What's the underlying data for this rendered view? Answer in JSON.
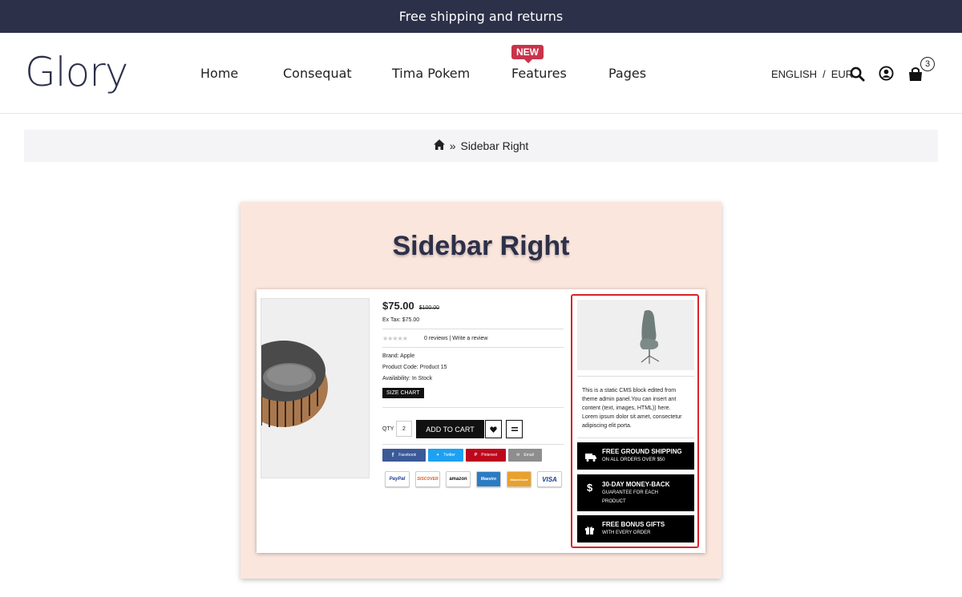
{
  "topbar": {
    "text": "Free shipping and returns"
  },
  "header": {
    "logo": "Glory",
    "nav": [
      {
        "label": "Home"
      },
      {
        "label": "Consequat"
      },
      {
        "label": "Tima Pokem"
      },
      {
        "label": "Features"
      },
      {
        "label": "Pages"
      }
    ],
    "new_badge": "NEW",
    "language": "ENGLISH",
    "separator": "/",
    "currency": "EUR",
    "cart_count": "3",
    "icons": [
      "search-icon",
      "user-icon",
      "cart-icon"
    ]
  },
  "breadcrumb": {
    "home_icon": "home-icon",
    "separator": "»",
    "current": "Sidebar Right"
  },
  "card": {
    "title": "Sidebar Right",
    "product": {
      "price": "$75.00",
      "old_price": "$100.00",
      "ex_tax": "Ex Tax: $75.00",
      "reviews": "0 reviews | Write a review",
      "brand": "Brand: Apple",
      "code": "Product Code: Product 15",
      "availability": "Availability: In Stock",
      "size_chart": "SIZE CHART",
      "qty_label": "QTY",
      "qty": "2",
      "add_to_cart": "ADD TO CART",
      "social": [
        "Facebook",
        "Twitter",
        "Pinterest",
        "Email"
      ],
      "payments": [
        "PayPal",
        "DISCOVER",
        "amazon",
        "Maestro",
        "MasterCard",
        "VISA"
      ]
    },
    "sidebar": {
      "cms_text": "This is a static CMS block edited from theme admin panel.You can insert ant content (text, images, HTML)) here. Lorem ipsum dolor sit amet, consectetur adipiscing elit porta.",
      "features": [
        {
          "title": "FREE GROUND SHIPPING",
          "sub": "ON ALL ORDERS OVER $50",
          "icon": "truck-icon"
        },
        {
          "title": "30-DAY MONEY-BACK",
          "sub": "GUARANTEE FOR EACH",
          "sub2": "PRODUCT",
          "icon": "dollar-icon"
        },
        {
          "title": "FREE BONUS GIFTS",
          "sub": "WITH EVERY ORDER",
          "icon": "gift-icon"
        }
      ]
    }
  },
  "colors": {
    "dark": "#2d3049",
    "badge": "#c8334b",
    "card_bg": "#fbe6dd",
    "highlight": "#d8232a"
  }
}
